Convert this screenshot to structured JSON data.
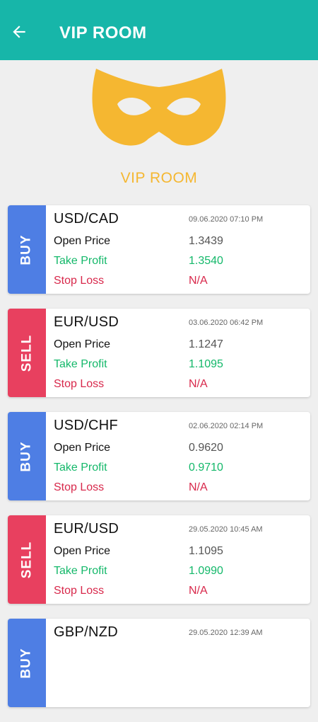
{
  "header": {
    "title": "VIP ROOM",
    "back_icon": "arrow-left-icon"
  },
  "hero": {
    "icon": "mask-icon",
    "label": "VIP ROOM"
  },
  "labels": {
    "open_price": "Open Price",
    "take_profit": "Take Profit",
    "stop_loss": "Stop Loss"
  },
  "colors": {
    "primary": "#17b6a9",
    "accent": "#f5b731",
    "buy": "#4e7ee4",
    "sell": "#e8405f",
    "take_profit": "#14b86a",
    "stop_loss": "#d8284b"
  },
  "signals": [
    {
      "side": "BUY",
      "pair": "USD/CAD",
      "date": "09.06.2020 07:10 PM",
      "open_price": "1.3439",
      "take_profit": "1.3540",
      "stop_loss": "N/A"
    },
    {
      "side": "SELL",
      "pair": "EUR/USD",
      "date": "03.06.2020 06:42 PM",
      "open_price": "1.1247",
      "take_profit": "1.1095",
      "stop_loss": "N/A"
    },
    {
      "side": "BUY",
      "pair": "USD/CHF",
      "date": "02.06.2020 02:14 PM",
      "open_price": "0.9620",
      "take_profit": "0.9710",
      "stop_loss": "N/A"
    },
    {
      "side": "SELL",
      "pair": "EUR/USD",
      "date": "29.05.2020 10:45 AM",
      "open_price": "1.1095",
      "take_profit": "1.0990",
      "stop_loss": "N/A"
    },
    {
      "side": "BUY",
      "pair": "GBP/NZD",
      "date": "29.05.2020 12:39 AM",
      "open_price": "",
      "take_profit": "",
      "stop_loss": ""
    }
  ]
}
